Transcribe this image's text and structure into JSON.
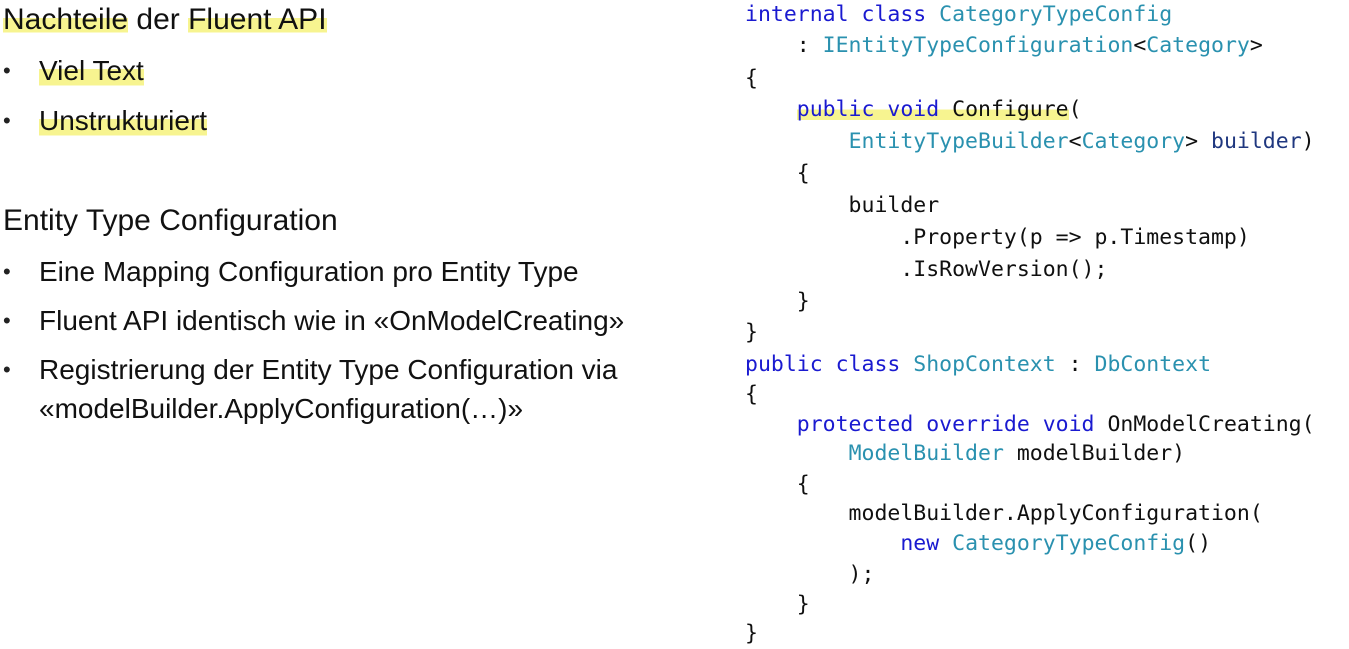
{
  "left": {
    "section1": {
      "title_part1": "Nachteile",
      "title_part2": " der ",
      "title_part3": "Fluent API",
      "bullets": [
        "Viel Text",
        "Unstrukturiert"
      ]
    },
    "section2": {
      "title": "Entity Type Configuration",
      "bullets": [
        "Eine Mapping Configuration pro Entity Type",
        "Fluent API identisch wie in «OnModelCreating»",
        "Registrierung der Entity Type Configuration via",
        "«modelBuilder.ApplyConfiguration(…)»"
      ]
    },
    "bullet_glyph": "•"
  },
  "code": {
    "l1": {
      "a": "internal class ",
      "b": "CategoryTypeConfig"
    },
    "l2": {
      "a": "    : ",
      "b": "IEntityTypeConfiguration",
      "c": "<",
      "d": "Category",
      "e": ">"
    },
    "l3": "{",
    "l4": {
      "a": "    ",
      "b": "public void ",
      "c": "Configure",
      "d": "("
    },
    "l5": {
      "a": "        ",
      "b": "EntityTypeBuilder",
      "c": "<",
      "d": "Category",
      "e": "> ",
      "f": "builder",
      ")": ")"
    },
    "l6": "    {",
    "l7": "        builder",
    "l8": "            .Property(p => p.Timestamp)",
    "l9": "            .IsRowVersion();",
    "l10": "    }",
    "l11": "}",
    "l12": {
      "a": "public class ",
      "b": "ShopContext",
      "c": " : ",
      "d": "DbContext"
    },
    "l13": "{",
    "l14": {
      "a": "    ",
      "b": "protected override void ",
      "c": "OnModelCreating("
    },
    "l15": {
      "a": "        ",
      "b": "ModelBuilder",
      "c": " modelBuilder)"
    },
    "l16": "    {",
    "l17": "        modelBuilder.ApplyConfiguration(",
    "l18": {
      "a": "            ",
      "b": "new ",
      "c": "CategoryTypeConfig",
      "d": "()"
    },
    "l19": "        );",
    "l20": "    }",
    "l21": "}"
  }
}
